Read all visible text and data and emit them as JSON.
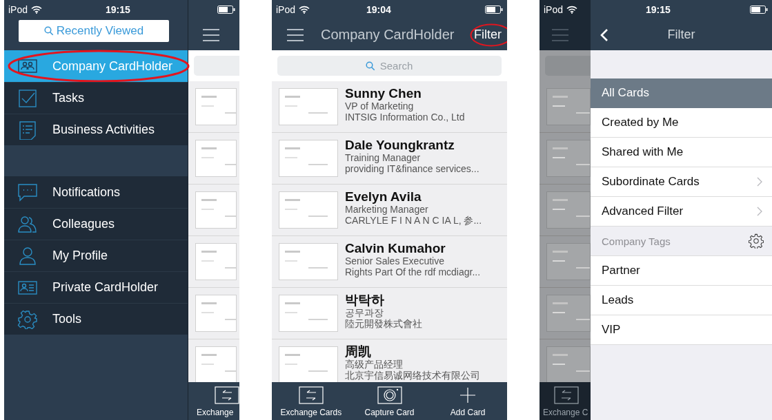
{
  "menu_screen": {
    "status_bar": {
      "carrier": "iPod",
      "time": "19:15"
    },
    "recent_button": "Recently Viewed",
    "sections": [
      {
        "items": [
          {
            "label": "Company CardHolder",
            "selected": true,
            "circled": true
          },
          {
            "label": "Tasks",
            "selected": false,
            "circled": false
          },
          {
            "label": "Business Activities",
            "selected": false,
            "circled": false
          }
        ]
      },
      {
        "items": [
          {
            "label": "Notifications",
            "selected": false,
            "circled": false
          },
          {
            "label": "Colleagues",
            "selected": false,
            "circled": false
          },
          {
            "label": "My Profile",
            "selected": false,
            "circled": false
          },
          {
            "label": "Private CardHolder",
            "selected": false,
            "circled": false
          },
          {
            "label": "Tools",
            "selected": false,
            "circled": false
          }
        ]
      }
    ],
    "background_tab_label": "Exchange"
  },
  "list_screen": {
    "status_bar": {
      "carrier": "iPod",
      "time": "19:04"
    },
    "title": "Company CardHolder",
    "filter_button": {
      "label": "Filter",
      "circled": true
    },
    "search_placeholder": "Search",
    "contacts": [
      {
        "name": "Sunny Chen",
        "title": "VP of Marketing",
        "company": "INTSIG Information Co., Ltd"
      },
      {
        "name": "Dale Youngkrantz",
        "title": "Training Manager",
        "company": "providing IT&finance services..."
      },
      {
        "name": "Evelyn Avila",
        "title": "Marketing Manager",
        "company": "CARLYLE F I N A N C IA L, 参..."
      },
      {
        "name": "Calvin Kumahor",
        "title": "Senior Sales Executive",
        "company": "Rights Part Of the rdf mcdiagr..."
      },
      {
        "name": "박탁하",
        "title": "공무과장",
        "company": "陸元開發株式會社"
      },
      {
        "name": "周凯",
        "title": "高级产品经理",
        "company": "北京宇信易诚网络技术有限公司"
      }
    ],
    "tabs": [
      "Exchange Cards",
      "Capture Card",
      "Add Card"
    ]
  },
  "filter_screen": {
    "status_bar": {
      "carrier": "iPod",
      "time": "19:15"
    },
    "title": "Filter",
    "options": [
      {
        "label": "All Cards",
        "selected": true,
        "has_arrow": false
      },
      {
        "label": "Created by Me",
        "selected": false,
        "has_arrow": false
      },
      {
        "label": "Shared with Me",
        "selected": false,
        "has_arrow": false
      },
      {
        "label": "Subordinate Cards",
        "selected": false,
        "has_arrow": true
      },
      {
        "label": "Advanced Filter",
        "selected": false,
        "has_arrow": true
      }
    ],
    "tags_header": "Company Tags",
    "tags": [
      {
        "label": "Partner",
        "selected": false
      },
      {
        "label": "Leads",
        "selected": false
      },
      {
        "label": "VIP",
        "selected": false
      }
    ],
    "background_tab_label": "Exchange C"
  }
}
